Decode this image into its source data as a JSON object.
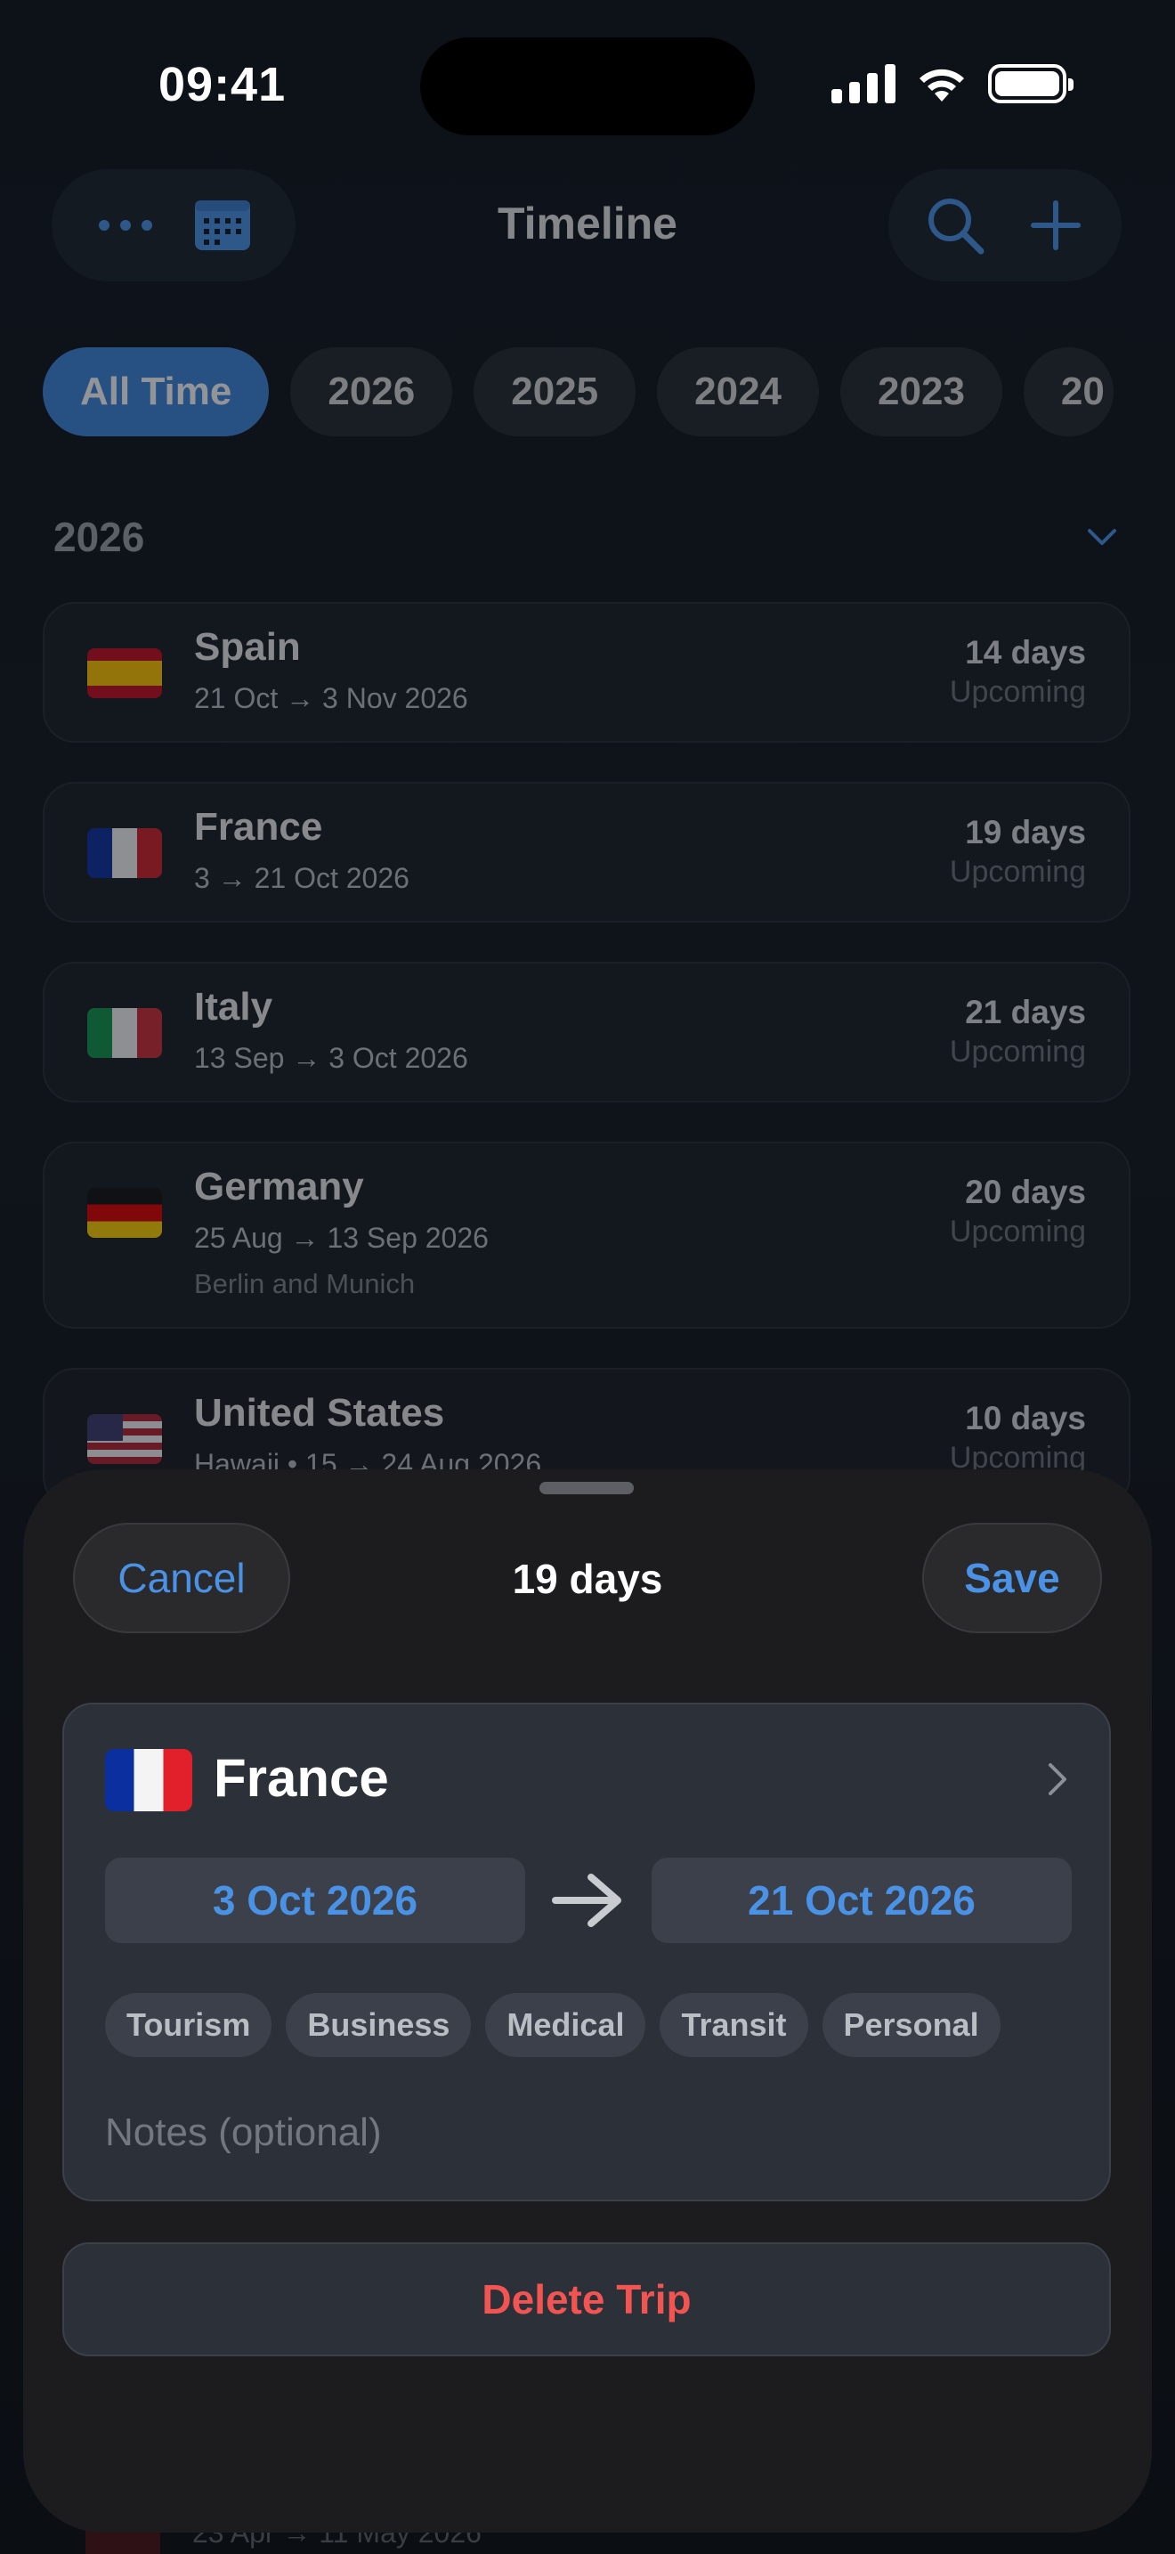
{
  "status": {
    "time": "09:41"
  },
  "nav": {
    "title": "Timeline"
  },
  "filters": [
    "All Time",
    "2026",
    "2025",
    "2024",
    "2023",
    "20"
  ],
  "section": {
    "title": "2026"
  },
  "trips": [
    {
      "name": "Spain",
      "dates": "21 Oct → 3 Nov 2026",
      "days": "14 days",
      "state": "Upcoming",
      "notes": ""
    },
    {
      "name": "France",
      "dates": "3 → 21 Oct 2026",
      "days": "19 days",
      "state": "Upcoming",
      "notes": ""
    },
    {
      "name": "Italy",
      "dates": "13 Sep → 3 Oct 2026",
      "days": "21 days",
      "state": "Upcoming",
      "notes": ""
    },
    {
      "name": "Germany",
      "dates": "25 Aug → 13 Sep 2026",
      "days": "20 days",
      "state": "Upcoming",
      "notes": "Berlin and Munich"
    },
    {
      "name": "United States",
      "dates": "Hawaii • 15 → 24 Aug 2026",
      "days": "10 days",
      "state": "Upcoming",
      "notes": ""
    }
  ],
  "sheet": {
    "cancel": "Cancel",
    "title": "19 days",
    "save": "Save",
    "country": "France",
    "start_date": "3 Oct 2026",
    "end_date": "21 Oct 2026",
    "tags": [
      "Tourism",
      "Business",
      "Medical",
      "Transit",
      "Personal"
    ],
    "notes_placeholder": "Notes (optional)",
    "delete": "Delete Trip"
  },
  "peek": {
    "dates": "23 Apr → 11 May 2026"
  },
  "colors": {
    "accent": "#4a92e6",
    "danger": "#f25451",
    "active_chip": "#3f84d9"
  }
}
